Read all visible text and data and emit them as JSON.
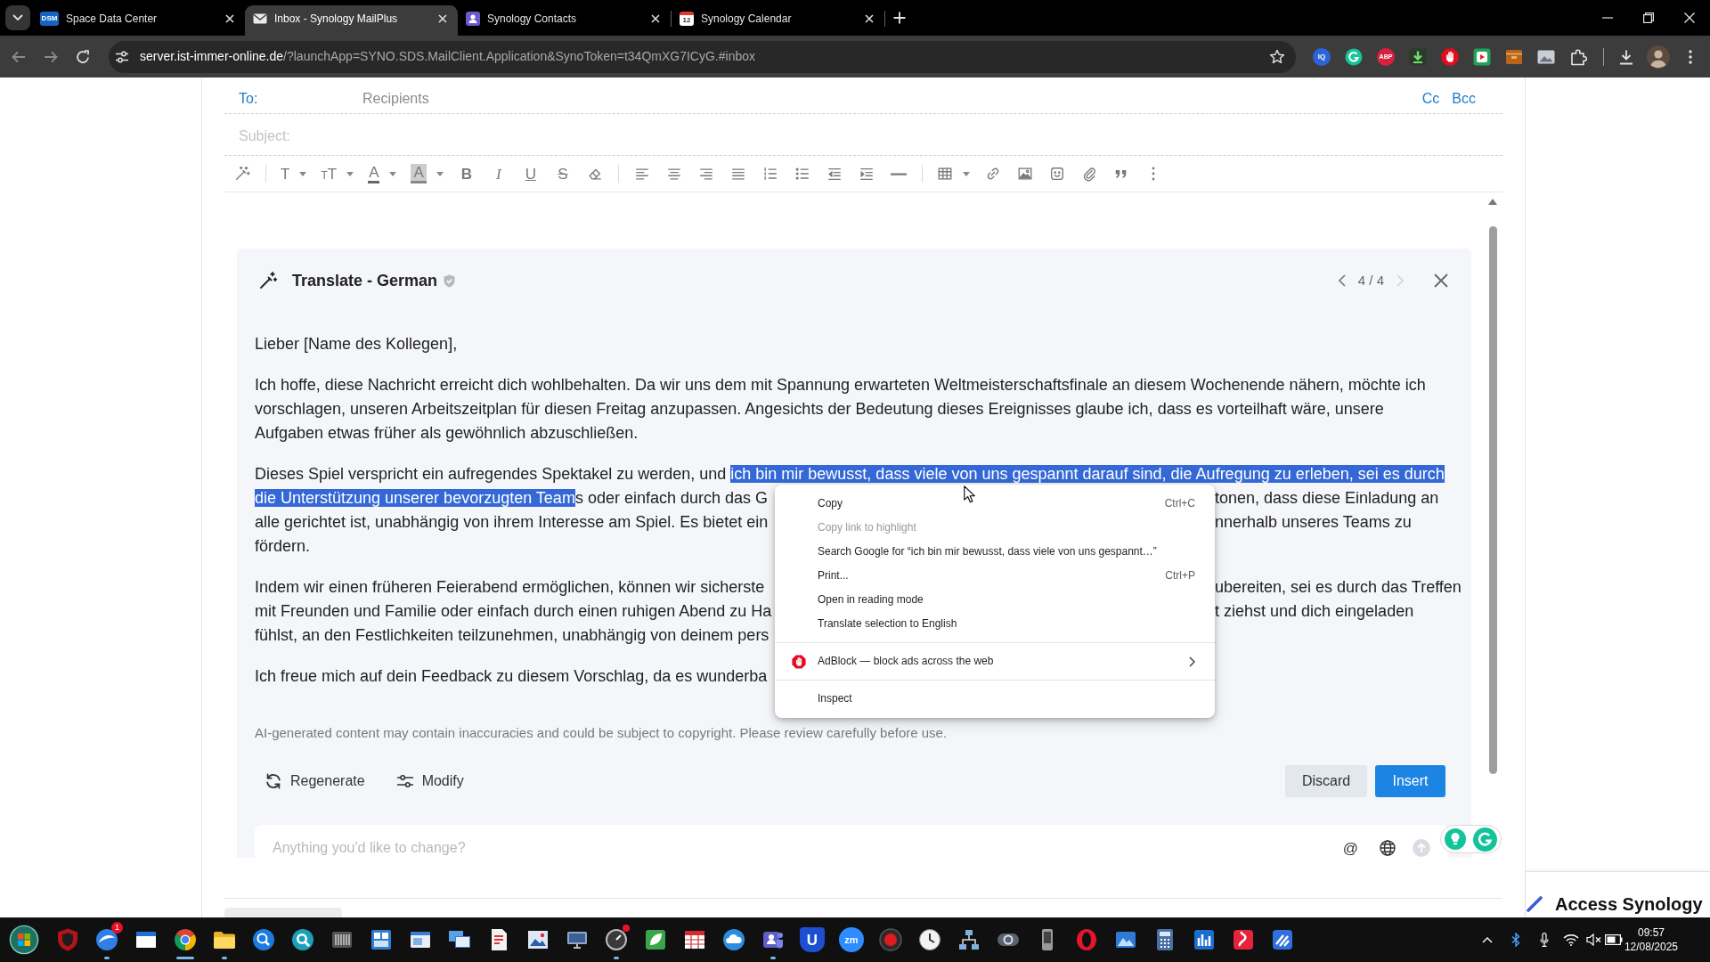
{
  "browser": {
    "tabs": [
      {
        "title": "Space Data Center",
        "icon_text": "DSM",
        "selected": false
      },
      {
        "title": "Inbox - Synology MailPlus",
        "selected": true
      },
      {
        "title": "Synology Contacts",
        "selected": false
      },
      {
        "title": "Synology Calendar",
        "icon_text": "12",
        "selected": false
      }
    ],
    "back": {
      "disabled": true
    },
    "forward": {
      "disabled": true
    },
    "url": {
      "host": "server.ist-immer-online.de",
      "path": "/?launchApp=SYNO.SDS.MailClient.Application&SynoToken=t34QmXG7ICyG.#inbox"
    },
    "extensions": [
      {
        "kind": "lettered",
        "text": "IQ"
      },
      {
        "kind": "drawn"
      },
      {
        "kind": "lettered",
        "text": "ABP"
      },
      {
        "kind": "drawn"
      },
      {
        "kind": "drawn"
      },
      {
        "kind": "drawn"
      },
      {
        "kind": "drawn"
      },
      {
        "kind": "drawn"
      },
      {
        "kind": "drawn"
      }
    ]
  },
  "compose": {
    "to_label": "To:",
    "recipients_placeholder": "Recipients",
    "cc": "Cc",
    "bcc": "Bcc",
    "subject_placeholder": "Subject:",
    "toolbar": [
      {
        "kind": "icon",
        "dropdown": false
      },
      {
        "kind": "separator"
      },
      {
        "kind": "letter",
        "text": "T",
        "dropdown": true
      },
      {
        "kind": "letter",
        "text": "TT",
        "dropdown": true
      },
      {
        "kind": "letter",
        "text": "A",
        "dropdown": true
      },
      {
        "kind": "letter",
        "text": "A",
        "dropdown": true
      },
      {
        "kind": "letter",
        "text": "B",
        "dropdown": false
      },
      {
        "kind": "letter",
        "text": "I",
        "dropdown": false
      },
      {
        "kind": "letter",
        "text": "U",
        "dropdown": false
      },
      {
        "kind": "letter",
        "text": "S",
        "dropdown": false
      },
      {
        "kind": "icon",
        "dropdown": false
      },
      {
        "kind": "separator"
      },
      {
        "kind": "icon",
        "dropdown": false
      },
      {
        "kind": "icon",
        "dropdown": false
      },
      {
        "kind": "icon",
        "dropdown": false
      },
      {
        "kind": "icon",
        "dropdown": false
      },
      {
        "kind": "icon",
        "dropdown": false
      },
      {
        "kind": "icon",
        "dropdown": false
      },
      {
        "kind": "icon",
        "dropdown": false
      },
      {
        "kind": "icon",
        "dropdown": false
      },
      {
        "kind": "icon",
        "dropdown": false
      },
      {
        "kind": "separator"
      },
      {
        "kind": "icon",
        "dropdown": true
      },
      {
        "kind": "icon",
        "dropdown": false
      },
      {
        "kind": "icon",
        "dropdown": false
      },
      {
        "kind": "icon",
        "dropdown": false
      },
      {
        "kind": "icon",
        "dropdown": false
      },
      {
        "kind": "icon",
        "dropdown": false
      },
      {
        "kind": "icon",
        "dropdown": false
      }
    ],
    "assistant": {
      "title": "Translate - German",
      "prev": {
        "disabled": false
      },
      "pager": "4 / 4",
      "next": {
        "disabled": true
      },
      "paragraphs": [
        {
          "lines": [
            {
              "left": [
                {
                  "text": "Lieber [Name des Kollegen],",
                  "selected": false
                }
              ]
            }
          ]
        },
        {
          "lines": [
            {
              "left": [
                {
                  "text": "Ich hoffe, diese Nachricht erreicht dich wohlbehalten. Da wir uns dem mit Spannung erwarteten Weltmeisterschaftsfinale an diesem Wochenende nähern, möchte ich",
                  "selected": false
                }
              ]
            },
            {
              "left": [
                {
                  "text": "vorschlagen, unseren Arbeitszeitplan für diesen Freitag anzupassen. Angesichts der Bedeutung dieses Ereignisses glaube ich, dass es vorteilhaft wäre, unsere",
                  "selected": false
                }
              ]
            },
            {
              "left": [
                {
                  "text": "Aufgaben etwas früher als gewöhnlich abzuschließen.",
                  "selected": false
                }
              ]
            }
          ]
        },
        {
          "lines": [
            {
              "left": [
                {
                  "text": "Dieses Spiel verspricht ein aufregendes Spektakel zu werden, und ",
                  "selected": false
                },
                {
                  "text": "ich bin mir bewusst, dass viele von uns gespannt darauf sind, die Aufregung zu erleben, sei es durch",
                  "selected": true
                }
              ]
            },
            {
              "left": [
                {
                  "text": "die Unterstützung unserer bevorzugten Team",
                  "selected": true
                },
                {
                  "text": "s oder einfach durch das G",
                  "selected": false
                }
              ],
              "right": [
                {
                  "text": "tonen, dass diese Einladung an",
                  "selected": false
                }
              ]
            },
            {
              "left": [
                {
                  "text": "alle gerichtet ist, unabhängig von ihrem Interesse am Spiel. Es bietet ein",
                  "selected": false
                }
              ],
              "right": [
                {
                  "text": "nnerhalb unseres Teams zu",
                  "selected": false
                }
              ]
            },
            {
              "left": [
                {
                  "text": "fördern.",
                  "selected": false
                }
              ]
            }
          ]
        },
        {
          "lines": [
            {
              "left": [
                {
                  "text": "Indem wir einen früheren Feierabend ermöglichen, können wir sicherste",
                  "selected": false
                }
              ],
              "right": [
                {
                  "text": "ubereiten, sei es durch das Treffen",
                  "selected": false
                }
              ]
            },
            {
              "left": [
                {
                  "text": "mit Freunden und Familie oder einfach durch einen ruhigen Abend zu Ha",
                  "selected": false
                }
              ],
              "right": [
                {
                  "text": "t ziehst und dich eingeladen",
                  "selected": false
                }
              ]
            },
            {
              "left": [
                {
                  "text": "fühlst, an den Festlichkeiten teilzunehmen, unabhängig von deinem pers",
                  "selected": false
                }
              ]
            }
          ]
        },
        {
          "lines": [
            {
              "left": [
                {
                  "text": "Ich freue mich auf dein Feedback zu diesem Vorschlag, da es wunderba",
                  "selected": false
                }
              ]
            }
          ]
        }
      ],
      "disclaimer": "AI-generated content may contain inaccuracies and could be subject to copyright. Please review carefully before use.",
      "actions": [
        "Regenerate",
        "Modify"
      ],
      "discard": "Discard",
      "insert": "Insert",
      "prompt_placeholder": "Anything you'd like to change?",
      "mention": "@",
      "send": {
        "disabled": true
      }
    }
  },
  "context_menu": {
    "items": [
      {
        "kind": "item",
        "label": "Copy",
        "shortcut": "Ctrl+C",
        "disabled": false,
        "submenu": false
      },
      {
        "kind": "item",
        "label": "Copy link to highlight",
        "disabled": true,
        "submenu": false
      },
      {
        "kind": "item",
        "label": "Search Google for “ich bin mir bewusst, dass viele von uns gespannt…”",
        "disabled": false,
        "submenu": false
      },
      {
        "kind": "item",
        "label": "Print...",
        "shortcut": "Ctrl+P",
        "disabled": false,
        "submenu": false
      },
      {
        "kind": "item",
        "label": "Open in reading mode",
        "disabled": false,
        "submenu": false
      },
      {
        "kind": "item",
        "label": "Translate selection to English",
        "disabled": false,
        "submenu": false
      },
      {
        "kind": "separator"
      },
      {
        "kind": "extension",
        "label": "AdBlock — block ads across the web",
        "disabled": false,
        "submenu": true
      },
      {
        "kind": "separator"
      },
      {
        "kind": "item",
        "label": "Inspect",
        "disabled": false,
        "submenu": false
      }
    ]
  },
  "access_banner": {
    "text": "Access Synology"
  },
  "taskbar": {
    "apps": [
      {
        "running": false,
        "selected": false,
        "alert": false
      },
      {
        "running": true,
        "selected": false,
        "alert": false,
        "badge": "1"
      },
      {
        "running": false,
        "selected": false,
        "alert": false
      },
      {
        "running": true,
        "selected": true,
        "alert": false
      },
      {
        "running": true,
        "selected": false,
        "alert": false
      },
      {
        "running": false,
        "selected": false,
        "alert": false
      },
      {
        "running": false,
        "selected": false,
        "alert": false
      },
      {
        "running": false,
        "selected": false,
        "alert": false
      },
      {
        "running": false,
        "selected": false,
        "alert": false
      },
      {
        "running": false,
        "selected": false,
        "alert": false
      },
      {
        "running": false,
        "selected": false,
        "alert": false
      },
      {
        "running": false,
        "selected": false,
        "alert": false
      },
      {
        "running": false,
        "selected": false,
        "alert": false
      },
      {
        "running": false,
        "selected": false,
        "alert": false
      },
      {
        "running": true,
        "selected": false,
        "alert": true
      },
      {
        "running": false,
        "selected": false,
        "alert": false
      },
      {
        "running": false,
        "selected": false,
        "alert": false
      },
      {
        "running": false,
        "selected": false,
        "alert": false
      },
      {
        "running": true,
        "selected": false,
        "alert": false
      },
      {
        "running": false,
        "selected": false,
        "alert": false,
        "text": "U"
      },
      {
        "running": false,
        "selected": false,
        "alert": false,
        "text": "zm"
      },
      {
        "running": false,
        "selected": false,
        "alert": false
      },
      {
        "running": false,
        "selected": false,
        "alert": false
      },
      {
        "running": false,
        "selected": false,
        "alert": false
      },
      {
        "running": false,
        "selected": false,
        "alert": false
      },
      {
        "running": false,
        "selected": false,
        "alert": false
      },
      {
        "running": false,
        "selected": false,
        "alert": false
      },
      {
        "running": false,
        "selected": false,
        "alert": false
      },
      {
        "running": false,
        "selected": false,
        "alert": false
      },
      {
        "running": false,
        "selected": false,
        "alert": false
      },
      {
        "running": false,
        "selected": false,
        "alert": false
      },
      {
        "running": false,
        "selected": false,
        "alert": false
      }
    ],
    "clock": {
      "time": "09:57",
      "date": "12/08/2025"
    }
  }
}
